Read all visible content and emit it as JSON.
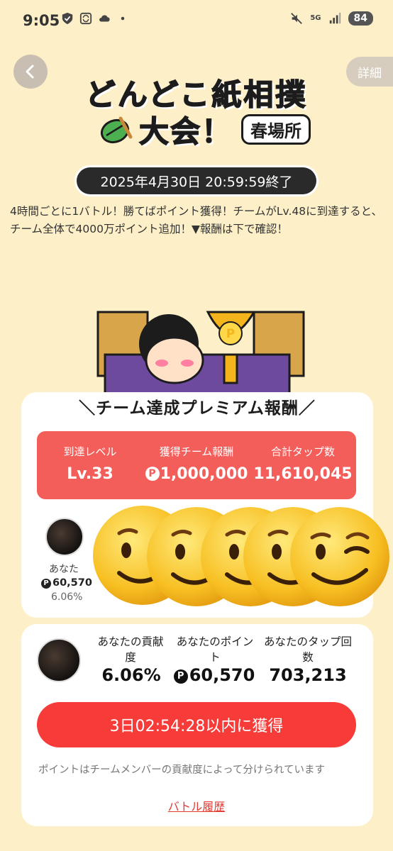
{
  "status_bar": {
    "time": "9:05",
    "battery": "84",
    "network": "5G",
    "icons_left": [
      "shield-check-icon",
      "sync-icon",
      "cloud-icon",
      "dot-icon"
    ],
    "icons_right": [
      "mute-icon",
      "signal-icon"
    ]
  },
  "header": {
    "back_icon": "chevron-left-icon",
    "detail_label": "詳細"
  },
  "event": {
    "title_line1": "どんどこ紙相撲",
    "title_line2": "大会！",
    "badge": "春場所",
    "deadline": "2025年4月30日 20:59:59終了",
    "description": "4時間ごとに1バトル！勝てばポイント獲得！チームがLv.48に到達すると、チーム全体で4000万ポイント追加！▼報酬は下で確認！"
  },
  "premium": {
    "title": "＼チーム達成プレミアム報酬／",
    "stats": [
      {
        "label": "到達レベル",
        "value": "Lv.33",
        "coin": false
      },
      {
        "label": "獲得チーム報酬",
        "value": "1,000,000",
        "coin": true
      },
      {
        "label": "合計タップ数",
        "value": "11,610,045",
        "coin": false
      }
    ]
  },
  "member": {
    "name": "あなた",
    "points": "60,570",
    "percent": "6.06%"
  },
  "contribution": {
    "items": [
      {
        "label": "あなたの貢献度",
        "value": "6.06%",
        "coin": false
      },
      {
        "label": "あなたのポイント",
        "value": "60,570",
        "coin": true
      },
      {
        "label": "あなたのタップ回数",
        "value": "703,213",
        "coin": false
      }
    ],
    "claim_button": "3日02:54:28以内に獲得",
    "note": "ポイントはチームメンバーの貢献度によって分けられています",
    "history_link": "バトル履歴"
  },
  "colors": {
    "background": "#fdefc8",
    "accent_red": "#f35e5a",
    "button_red": "#f63b38",
    "link_red": "#e23b33"
  }
}
